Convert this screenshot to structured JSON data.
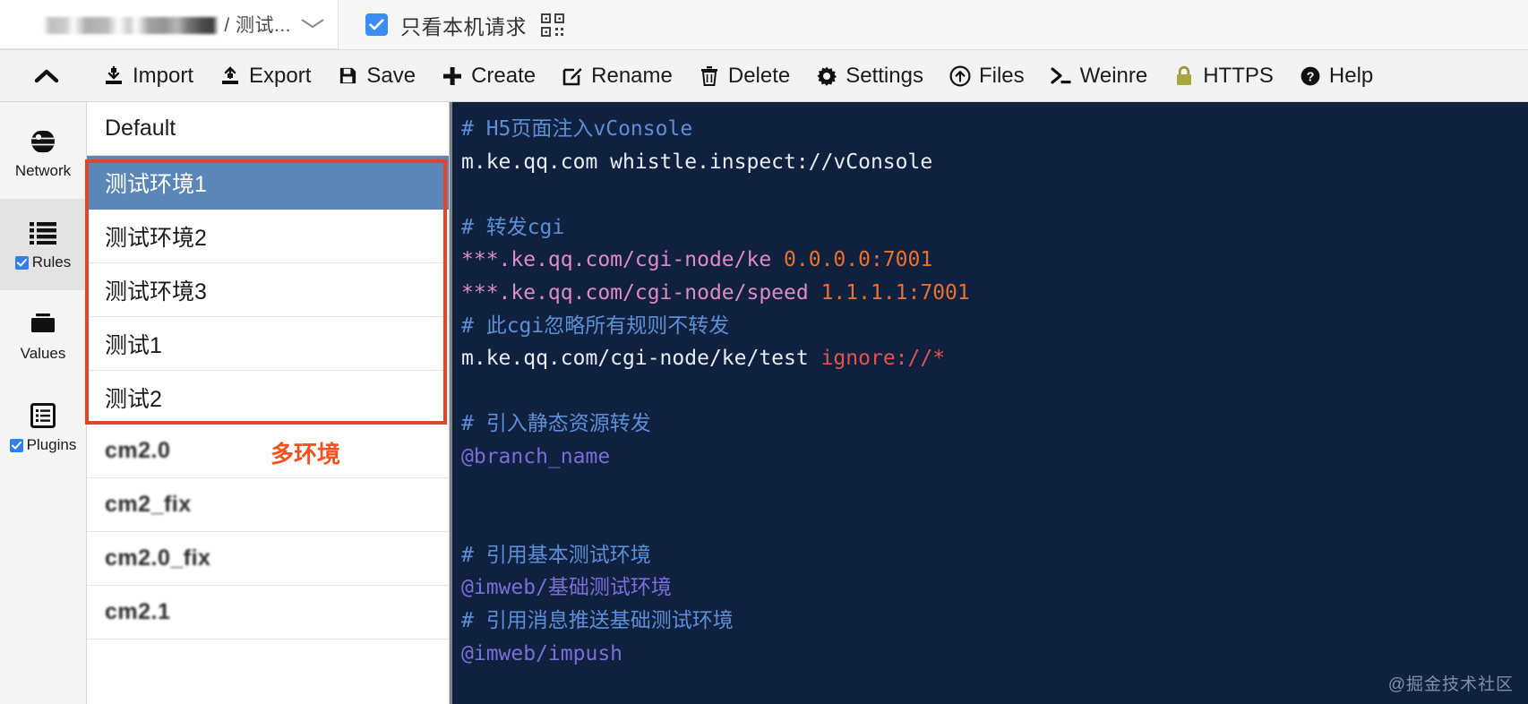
{
  "topbar": {
    "account_name_masked": "",
    "account_env_label": "/ 测试...",
    "dropdown_caret": "⌄",
    "local_only_label": "只看本机请求",
    "local_only_checked": true,
    "qr_icon": "qr-code-icon"
  },
  "toolbar": {
    "collapse_icon": "chevron-up-icon",
    "items": [
      {
        "label": "Import",
        "icon": "import-icon"
      },
      {
        "label": "Export",
        "icon": "export-icon"
      },
      {
        "label": "Save",
        "icon": "save-icon"
      },
      {
        "label": "Create",
        "icon": "plus-icon"
      },
      {
        "label": "Rename",
        "icon": "edit-square-icon"
      },
      {
        "label": "Delete",
        "icon": "trash-icon"
      },
      {
        "label": "Settings",
        "icon": "gear-icon"
      },
      {
        "label": "Files",
        "icon": "upload-circle-icon"
      },
      {
        "label": "Weinre",
        "icon": "terminal-icon"
      },
      {
        "label": "HTTPS",
        "icon": "lock-icon"
      },
      {
        "label": "Help",
        "icon": "question-circle-icon"
      }
    ]
  },
  "sidebar": {
    "items": [
      {
        "label": "Network",
        "icon": "globe-icon",
        "has_checkbox": false,
        "checked": false,
        "active": false
      },
      {
        "label": "Rules",
        "icon": "list-icon",
        "has_checkbox": true,
        "checked": true,
        "active": true
      },
      {
        "label": "Values",
        "icon": "folder-icon",
        "has_checkbox": false,
        "checked": false,
        "active": false
      },
      {
        "label": "Plugins",
        "icon": "plugin-list-icon",
        "has_checkbox": true,
        "checked": true,
        "active": false
      }
    ]
  },
  "rules_list": {
    "items": [
      {
        "name": "Default",
        "selected": false,
        "blurred": false
      },
      {
        "name": "测试环境1",
        "selected": true,
        "blurred": false
      },
      {
        "name": "测试环境2",
        "selected": false,
        "blurred": false
      },
      {
        "name": "测试环境3",
        "selected": false,
        "blurred": false
      },
      {
        "name": "测试1",
        "selected": false,
        "blurred": false
      },
      {
        "name": "测试2",
        "selected": false,
        "blurred": false
      },
      {
        "name": "cm2.0",
        "selected": false,
        "blurred": true
      },
      {
        "name": "cm2_fix",
        "selected": false,
        "blurred": true
      },
      {
        "name": "cm2.0_fix",
        "selected": false,
        "blurred": true
      },
      {
        "name": "cm2.1",
        "selected": false,
        "blurred": true
      }
    ]
  },
  "annotation": {
    "box_label": "多环境",
    "box_color": "#e2462a",
    "text_color": "#f4511e"
  },
  "editor": {
    "watermark": "@掘金技术社区",
    "background": "#10203f",
    "lines": [
      [
        {
          "t": "# H5页面注入vConsole",
          "c": "c-comment"
        }
      ],
      [
        {
          "t": "m.ke.qq.com whistle.inspect://vConsole",
          "c": "c-plain"
        }
      ],
      [
        {
          "t": "",
          "c": "c-plain"
        }
      ],
      [
        {
          "t": "# 转发cgi",
          "c": "c-comment"
        }
      ],
      [
        {
          "t": "***.ke.qq.com/cgi-node/ke ",
          "c": "c-pattern"
        },
        {
          "t": "0.0.0.0:7001",
          "c": "c-value"
        }
      ],
      [
        {
          "t": "***.ke.qq.com/cgi-node/speed ",
          "c": "c-pattern"
        },
        {
          "t": "1.1.1.1:7001",
          "c": "c-value"
        }
      ],
      [
        {
          "t": "# 此cgi忽略所有规则不转发",
          "c": "c-comment"
        }
      ],
      [
        {
          "t": "m.ke.qq.com/cgi-node/ke/test ",
          "c": "c-plain"
        },
        {
          "t": "ignore://*",
          "c": "c-ignore"
        }
      ],
      [
        {
          "t": "",
          "c": "c-plain"
        }
      ],
      [
        {
          "t": "# 引入静态资源转发",
          "c": "c-comment"
        }
      ],
      [
        {
          "t": "@branch_name",
          "c": "c-at"
        }
      ],
      [
        {
          "t": "",
          "c": "c-plain"
        }
      ],
      [
        {
          "t": "",
          "c": "c-plain"
        }
      ],
      [
        {
          "t": "# 引用基本测试环境",
          "c": "c-comment"
        }
      ],
      [
        {
          "t": "@imweb/基础测试环境",
          "c": "c-at"
        }
      ],
      [
        {
          "t": "# 引用消息推送基础测试环境",
          "c": "c-comment"
        }
      ],
      [
        {
          "t": "@imweb/impush",
          "c": "c-at"
        }
      ]
    ]
  }
}
